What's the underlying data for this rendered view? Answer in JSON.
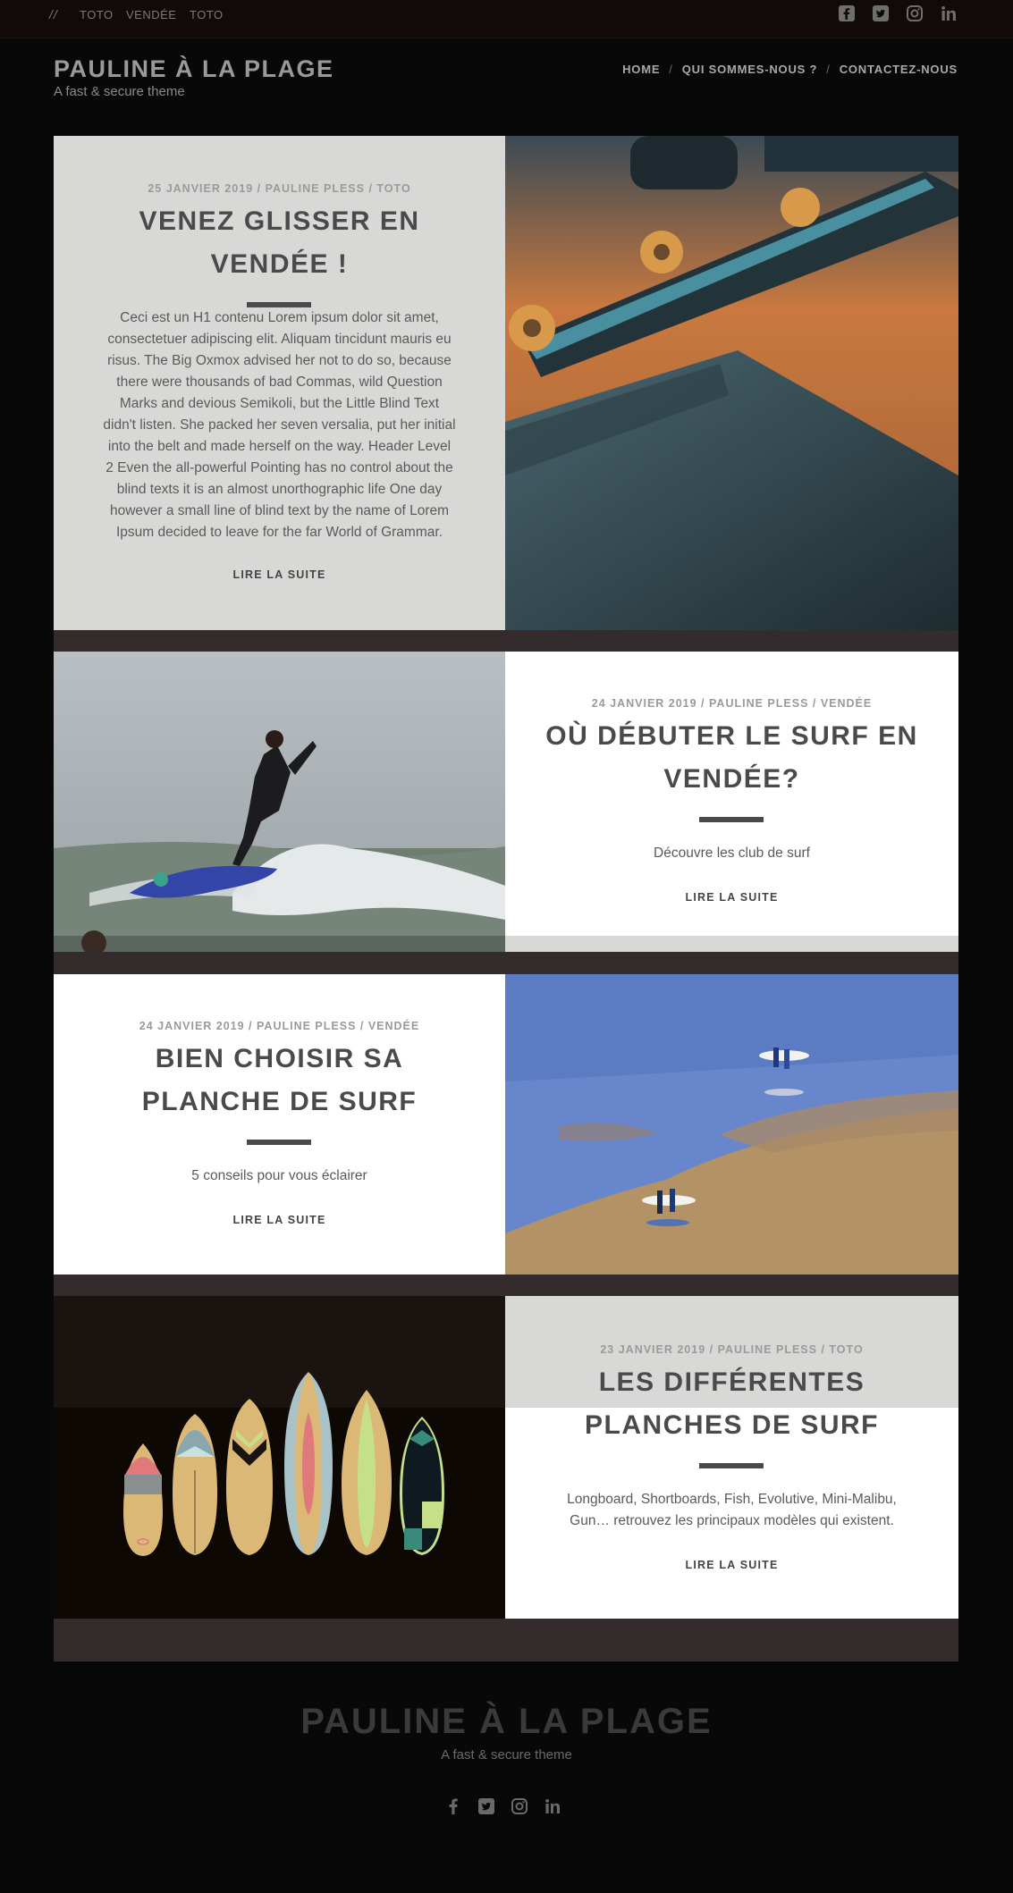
{
  "topbar": {
    "slashes": "//",
    "nav": [
      "TOTO",
      "VENDÉE",
      "TOTO"
    ],
    "social": [
      "facebook-square-icon",
      "twitter-square-icon",
      "instagram-icon",
      "linkedin-icon"
    ]
  },
  "header": {
    "title": "PAULINE À LA PLAGE",
    "tagline": "A fast & secure theme",
    "nav": [
      "HOME",
      "QUI SOMMES-NOUS ?",
      "CONTACTEZ-NOUS"
    ],
    "separator": "/"
  },
  "posts": [
    {
      "meta": "25 JANVIER 2019 / PAULINE PLESS / TOTO",
      "title_line1": "VENEZ GLISSER EN",
      "title_line2": "VENDÉE !",
      "excerpt": "Ceci est un H1 contenu Lorem ipsum dolor sit amet, consectetuer adipiscing elit. Aliquam tincidunt mauris eu risus. The Big Oxmox advised her not to do so, because there were thousands of bad Commas, wild Question Marks and devious Semikoli, but the Little Blind Text didn't listen. She packed her seven versalia, put her initial into the belt and made herself on the way. Header Level 2 Even the all-powerful Pointing has no control about the blind texts it is an almost unorthographic life One day however a small line of blind text by the name of Lorem Ipsum decided to leave for the far World of Grammar.",
      "more": "LIRE LA SUITE",
      "image": "skateboard-photo"
    },
    {
      "meta": "24 JANVIER 2019 / PAULINE PLESS / VENDÉE",
      "title_line1": "OÙ DÉBUTER LE SURF EN",
      "title_line2": "VENDÉE?",
      "excerpt": "Découvre les club de surf",
      "more": "LIRE LA SUITE",
      "image": "surfer-photo"
    },
    {
      "meta": "24 JANVIER 2019 / PAULINE PLESS / VENDÉE",
      "title_line1": "BIEN CHOISIR SA",
      "title_line2": "PLANCHE DE SURF",
      "excerpt": "5 conseils pour vous éclairer",
      "more": "LIRE LA SUITE",
      "image": "beach-surfers-photo"
    },
    {
      "meta": "23 JANVIER 2019 / PAULINE PLESS / TOTO",
      "title_line1": "LES DIFFÉRENTES",
      "title_line2": "PLANCHES DE SURF",
      "excerpt_line1": "Longboard, Shortboards, Fish, Evolutive, Mini-Malibu,",
      "excerpt_line2": "Gun… retrouvez les principaux modèles qui existent.",
      "more": "LIRE LA SUITE",
      "image": "surfboards-illustration"
    }
  ],
  "footer": {
    "title": "PAULINE À LA PLAGE",
    "tagline": "A fast & secure theme",
    "social": [
      "facebook-icon",
      "twitter-square-icon",
      "instagram-icon",
      "linkedin-icon"
    ]
  }
}
